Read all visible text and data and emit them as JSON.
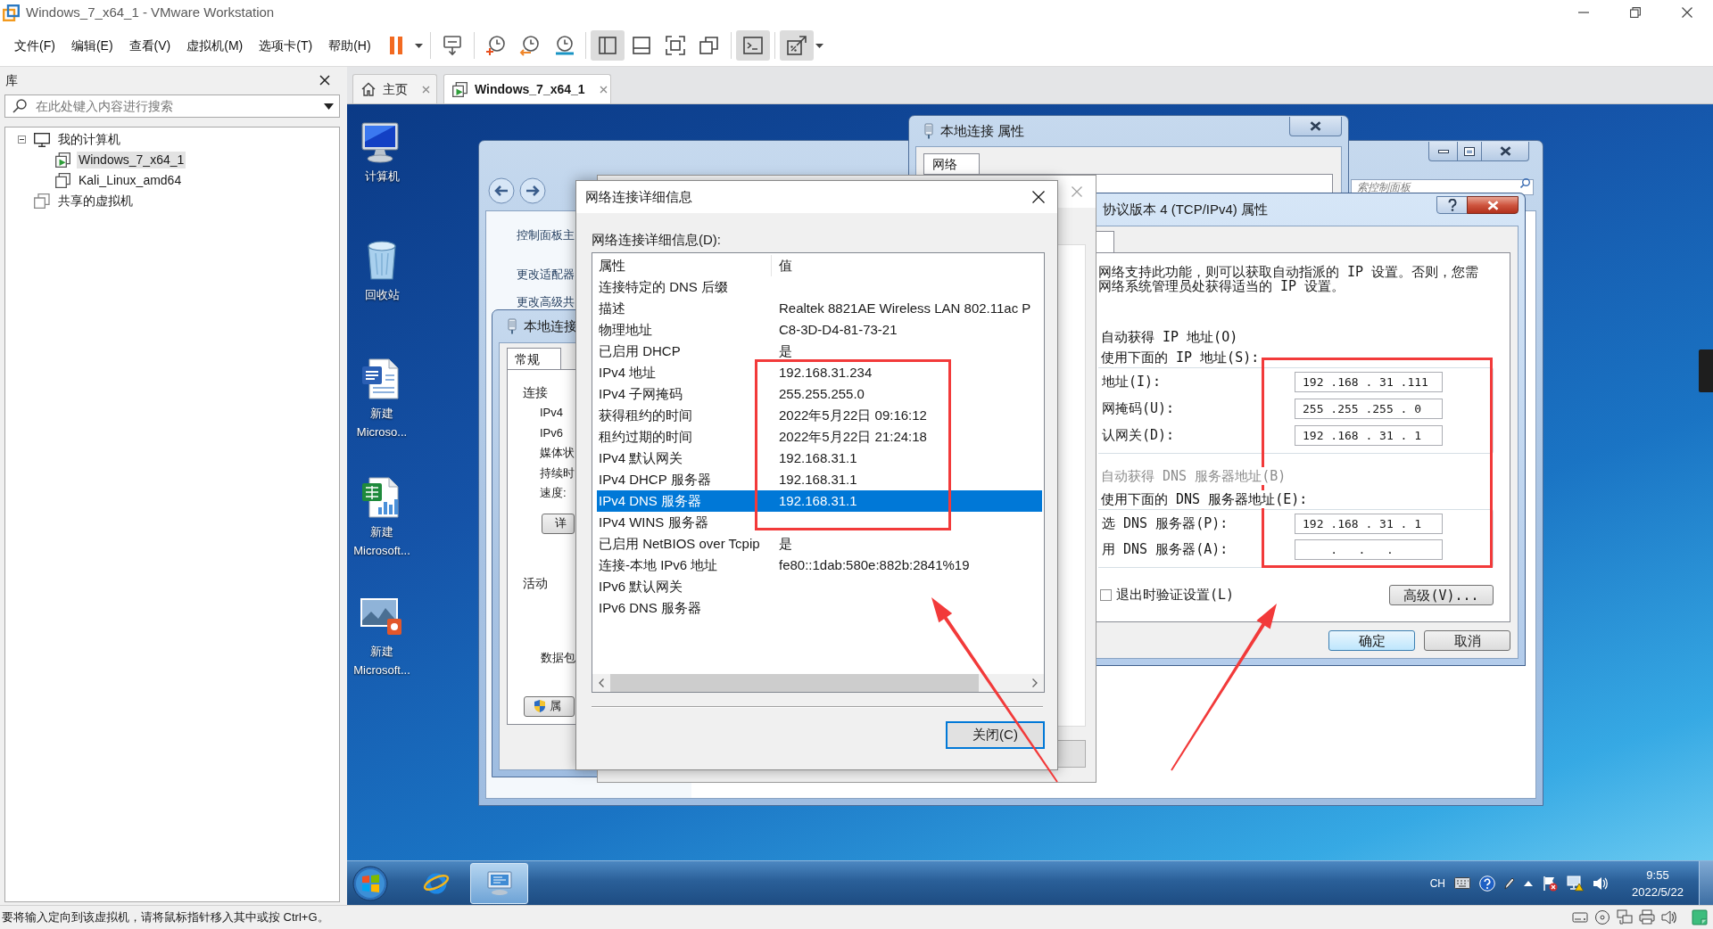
{
  "window": {
    "title": "Windows_7_x64_1 - VMware Workstation"
  },
  "menu": [
    "文件(F)",
    "编辑(E)",
    "查看(V)",
    "虚拟机(M)",
    "选项卡(T)",
    "帮助(H)"
  ],
  "toolbar": [
    {
      "kind": "pause",
      "pressed": false
    },
    {
      "kind": "caret",
      "pressed": false
    },
    {
      "kind": "separator"
    },
    {
      "kind": "send-keys",
      "pressed": false
    },
    {
      "kind": "separator"
    },
    {
      "kind": "snapshot",
      "pressed": false
    },
    {
      "kind": "revert",
      "pressed": false
    },
    {
      "kind": "snapshot-manager",
      "pressed": false
    },
    {
      "kind": "separator"
    },
    {
      "kind": "library-view",
      "pressed": true
    },
    {
      "kind": "thumbnail-view",
      "pressed": false
    },
    {
      "kind": "full-screen",
      "pressed": false
    },
    {
      "kind": "unity",
      "pressed": false
    },
    {
      "kind": "separator"
    },
    {
      "kind": "console",
      "pressed": true
    },
    {
      "kind": "separator"
    },
    {
      "kind": "stretch",
      "pressed": true
    },
    {
      "kind": "caret",
      "pressed": false
    }
  ],
  "library": {
    "title": "库",
    "search": {
      "placeholder": "在此处键入内容进行搜索"
    },
    "tree": [
      {
        "label": "我的计算机",
        "kind": "computer",
        "selected": false,
        "expanded": true,
        "children": [
          {
            "label": "Windows_7_x64_1",
            "kind": "vm",
            "running": true,
            "selected": true
          },
          {
            "label": "Kali_Linux_amd64",
            "kind": "vm",
            "running": false,
            "selected": false
          }
        ]
      },
      {
        "label": "共享的虚拟机",
        "kind": "shared",
        "selected": false
      }
    ]
  },
  "tabs": [
    {
      "label": "主页",
      "kind": "home",
      "selected": false
    },
    {
      "label": "Windows_7_x64_1",
      "kind": "vm",
      "selected": true
    }
  ],
  "guest": {
    "desktop_icons": [
      {
        "kind": "computer",
        "label": [
          "计算机"
        ]
      },
      {
        "kind": "recycle-bin",
        "label": [
          "回收站"
        ]
      },
      {
        "kind": "document",
        "label": [
          "新建",
          "Microso..."
        ]
      },
      {
        "kind": "spreadsheet",
        "label": [
          "新建",
          "Microsoft..."
        ]
      },
      {
        "kind": "presentation",
        "label": [
          "新建",
          "Microsoft..."
        ]
      }
    ],
    "control_panel": {
      "search": {
        "placeholder": "索控制面板"
      },
      "links": [
        "控制面板主",
        "更改适配器",
        "更改高级共"
      ]
    },
    "connection_status": {
      "title": "本地连接",
      "tabs": [
        {
          "label": "常规",
          "selected": true
        }
      ],
      "section": "连接",
      "fields": [
        "IPv4",
        "IPv6",
        "媒体状",
        "持续时",
        "速度:"
      ],
      "details_button": "详",
      "activity": "活动",
      "packets": "数据包",
      "properties_button": "属"
    },
    "connection_properties": {
      "title": "本地连接 属性",
      "tabs": [
        {
          "label": "网络",
          "selected": true
        }
      ]
    },
    "ipv4_properties": {
      "title": "协议版本 4 (TCP/IPv4) 属性",
      "intro": [
        "网络支持此功能，则可以获取自动指派的 IP 设置。否则，您需",
        "网络系统管理员处获得适当的 IP 设置。"
      ],
      "ip_mode": [
        {
          "label": "自动获得 IP 地址(O)",
          "disabled": false
        },
        {
          "label": "使用下面的 IP 地址(S):",
          "disabled": false
        }
      ],
      "ip_fields": [
        {
          "label": "地址(I):",
          "value": "192 .168 . 31 .111"
        },
        {
          "label": "网掩码(U):",
          "value": "255 .255 .255 . 0"
        },
        {
          "label": "认网关(D):",
          "value": "192 .168 . 31 . 1"
        }
      ],
      "dns_mode": [
        {
          "label": "自动获得 DNS 服务器地址(B)",
          "disabled": true
        },
        {
          "label": "使用下面的 DNS 服务器地址(E):",
          "disabled": false
        }
      ],
      "dns_fields": [
        {
          "label": "选 DNS 服务器(P):",
          "value": "192 .168 . 31 . 1"
        },
        {
          "label": "用 DNS 服务器(A):",
          "value": "    .   .   ."
        }
      ],
      "validate_on_exit": {
        "label": "退出时验证设置(L)",
        "checked": false
      },
      "advanced_button": "高级(V)...",
      "buttons": [
        {
          "label": "确定",
          "default": true
        },
        {
          "label": "取消",
          "default": false
        }
      ]
    },
    "details_dialog": {
      "title": "网络连接详细信息",
      "list_label": "网络连接详细信息(D):",
      "columns": [
        "属性",
        "值"
      ],
      "rows": [
        {
          "property": "连接特定的 DNS 后缀",
          "selected": false
        },
        {
          "property": "描述",
          "value": "Realtek 8821AE Wireless LAN 802.11ac P",
          "selected": false
        },
        {
          "property": "物理地址",
          "value": "C8-3D-D4-81-73-21",
          "selected": false
        },
        {
          "property": "已启用 DHCP",
          "value": "是",
          "selected": false
        },
        {
          "property": "IPv4 地址",
          "value": "192.168.31.234",
          "selected": false
        },
        {
          "property": "IPv4 子网掩码",
          "value": "255.255.255.0",
          "selected": false
        },
        {
          "property": "获得租约的时间",
          "value": "2022年5月22日 09:16:12",
          "selected": false
        },
        {
          "property": "租约过期的时间",
          "value": "2022年5月22日 21:24:18",
          "selected": false
        },
        {
          "property": "IPv4 默认网关",
          "value": "192.168.31.1",
          "selected": false
        },
        {
          "property": "IPv4 DHCP 服务器",
          "value": "192.168.31.1",
          "selected": false
        },
        {
          "property": "IPv4 DNS 服务器",
          "value": "192.168.31.1",
          "selected": true
        },
        {
          "property": "IPv4 WINS 服务器",
          "selected": false
        },
        {
          "property": "已启用 NetBIOS over Tcpip",
          "value": "是",
          "selected": false
        },
        {
          "property": "连接-本地 IPv6 地址",
          "value": "fe80::1dab:580e:882b:2841%19",
          "selected": false
        },
        {
          "property": "IPv6 默认网关",
          "selected": false
        },
        {
          "property": "IPv6 DNS 服务器",
          "selected": false
        }
      ],
      "close_button": "关闭(C)"
    },
    "annotations": [
      {
        "kind": "box"
      },
      {
        "kind": "box"
      },
      {
        "kind": "arrow"
      },
      {
        "kind": "arrow"
      }
    ],
    "taskbar": {
      "apps": [
        {
          "kind": "browser",
          "active": false
        },
        {
          "kind": "network-connections",
          "active": true
        }
      ],
      "tray": {
        "language": "CH",
        "icons": [
          {
            "kind": "keyboard"
          },
          {
            "kind": "help"
          },
          {
            "kind": "pen"
          },
          {
            "kind": "chevron"
          },
          {
            "kind": "flag"
          },
          {
            "kind": "network"
          },
          {
            "kind": "volume"
          }
        ],
        "time": "9:55",
        "date": "2022/5/22"
      }
    }
  },
  "status_bar": {
    "message": "要将输入定向到该虚拟机，请将鼠标指针移入其中或按 Ctrl+G。",
    "devices": [
      {
        "kind": "disk"
      },
      {
        "kind": "cd"
      },
      {
        "kind": "network"
      },
      {
        "kind": "printer"
      },
      {
        "kind": "sound"
      },
      {
        "kind": "note"
      }
    ]
  }
}
